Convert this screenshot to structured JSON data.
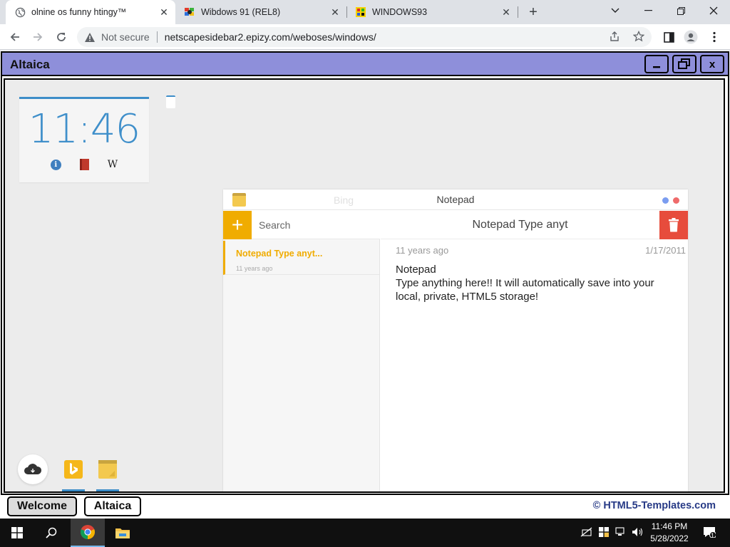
{
  "browser": {
    "tabs": [
      {
        "title": "olnine os funny htingy™",
        "active": true,
        "icon": "globe-icon"
      },
      {
        "title": "Wibdows 91 (REL8)",
        "active": false,
        "icon": "windows-flag-icon"
      },
      {
        "title": "WINDOWS93",
        "active": false,
        "icon": "w93-icon"
      }
    ],
    "new_tab": "+",
    "security_label": "Not secure",
    "url": "netscapesidebar2.epizy.com/weboses/windows/"
  },
  "app": {
    "title": "Altaica",
    "buttons": {
      "minimize": "–",
      "close": "x"
    },
    "clock": {
      "time": "11:46",
      "w_label": "W"
    },
    "notepad": {
      "ghost_label": "Bing",
      "title": "Notepad",
      "add_label": "+",
      "search_placeholder": "Search",
      "note_item": {
        "title": "Notepad Type anyt...",
        "age": "11 years ago"
      },
      "header_title": "Notepad Type anyt",
      "age": "11 years ago",
      "date": "1/17/2011",
      "body_line1": "Notepad",
      "body_line2": "Type anything here!! It will automatically save into your local, private, HTML5 storage!"
    }
  },
  "bottombar": {
    "tabs": [
      "Welcome",
      "Altaica"
    ],
    "credit": "© HTML5-Templates.com"
  },
  "taskbar": {
    "time": "11:46 PM",
    "date": "5/28/2022",
    "notifications": "1"
  },
  "colors": {
    "titlebar": "#8e8fda",
    "accent_blue": "#3d8dc8",
    "notepad_orange": "#f0ac00",
    "delete_red": "#e74c3c",
    "credit_blue": "#273a86"
  }
}
